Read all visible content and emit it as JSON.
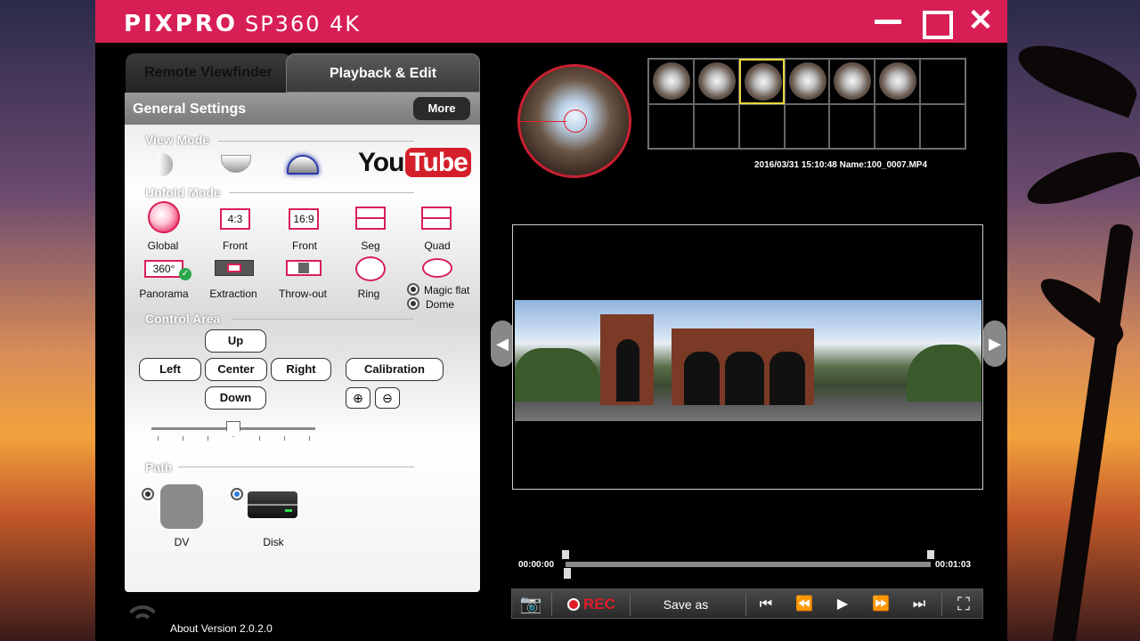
{
  "app": {
    "brand": "PIXPRO",
    "model": "SP360 4K",
    "about": "About Version 2.0.2.0"
  },
  "tabs": [
    {
      "label": "Remote Viewfinder"
    },
    {
      "label": "Playback & Edit"
    }
  ],
  "settings": {
    "title": "General Settings",
    "more_label": "More",
    "view_mode_label": "View Mode",
    "youtube_you": "You",
    "youtube_tube": "Tube",
    "unfold_mode_label": "Unfold Mode",
    "unfold_items": [
      {
        "label": "Global",
        "icon_text": ""
      },
      {
        "label": "Front",
        "icon_text": "4:3"
      },
      {
        "label": "Front",
        "icon_text": "16:9"
      },
      {
        "label": "Seg",
        "icon_text": ""
      },
      {
        "label": "Quad",
        "icon_text": ""
      },
      {
        "label": "Panorama",
        "icon_text": "360°"
      },
      {
        "label": "Extraction",
        "icon_text": ""
      },
      {
        "label": "Throw-out",
        "icon_text": ""
      },
      {
        "label": "Ring",
        "icon_text": ""
      }
    ],
    "magic_flat": "Magic flat",
    "dome": "Dome",
    "control_area_label": "Control Area",
    "controls": {
      "up": "Up",
      "left": "Left",
      "center": "Center",
      "right": "Right",
      "down": "Down",
      "calibration": "Calibration"
    },
    "path_label": "Path",
    "path_options": [
      {
        "label": "DV",
        "selected": false
      },
      {
        "label": "Disk",
        "selected": true
      }
    ]
  },
  "preview": {
    "meta": "2016/03/31 15:10:48 Name:100_0007.MP4",
    "selected_thumb": 3,
    "thumb_count": 6
  },
  "player": {
    "start_time": "00:00:00",
    "end_time": "00:01:03",
    "rec_label": "REC",
    "save_as_label": "Save as"
  },
  "colors": {
    "brand": "#d81f55",
    "rec": "#e01c2a",
    "selection": "#e8d83a"
  }
}
